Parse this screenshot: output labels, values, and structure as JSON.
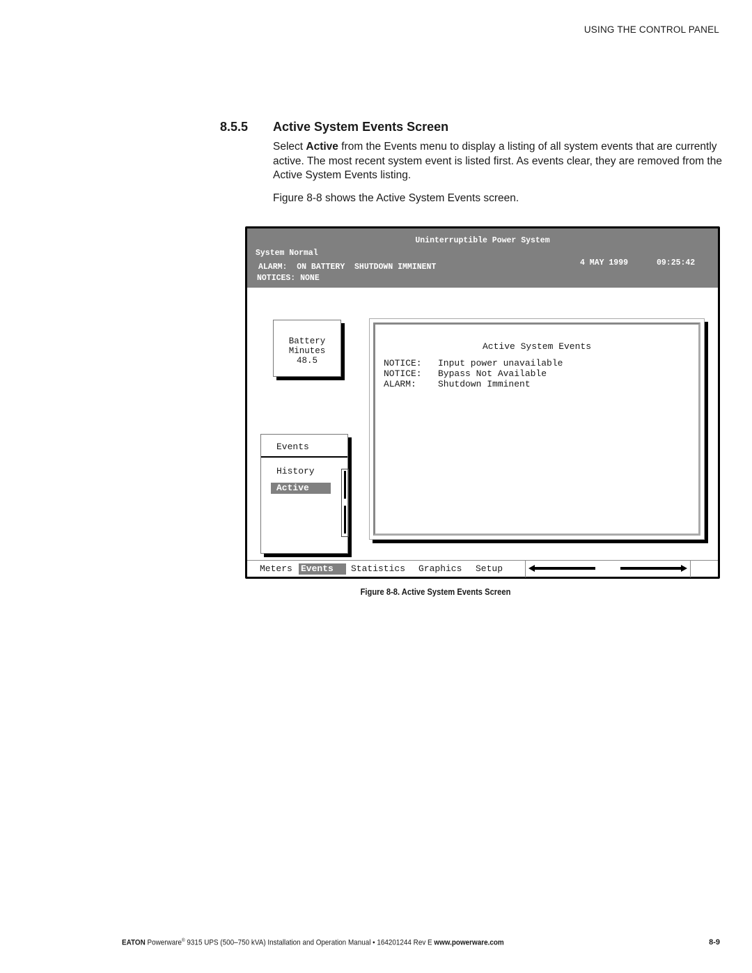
{
  "running_head": "USING THE CONTROL PANEL",
  "section": {
    "number": "8.5.5",
    "title": "Active System Events Screen",
    "para1_pre": "Select ",
    "para1_bold": "Active",
    "para1_post": " from the Events menu to display a listing of all system events that are currently active. The most recent system event is listed first. As events clear, they are removed from the Active System Events listing.",
    "para2": "Figure 8-8 shows the Active System Events screen."
  },
  "screen": {
    "header": {
      "title": "Uninterruptible Power System",
      "status": "System Normal",
      "alarm": "ALARM:  ON BATTERY  SHUTDOWN IMMINENT",
      "notices": "NOTICES: NONE",
      "date": "4 MAY 1999",
      "time": "09:25:42",
      "bg_color": "#808080"
    },
    "battery": {
      "line1": "Battery",
      "line2": "Minutes",
      "value": "48.5"
    },
    "events_panel": {
      "title": "Active System Events",
      "rows": [
        {
          "type": "NOTICE:",
          "message": "Input power unavailable"
        },
        {
          "type": "NOTICE:",
          "message": "Bypass Not Available"
        },
        {
          "type": "ALARM:",
          "message": "Shutdown Imminent"
        }
      ]
    },
    "menu": {
      "title": "Events",
      "items": [
        {
          "label": "History",
          "selected": false
        },
        {
          "label": "Active",
          "selected": true
        }
      ]
    },
    "tabs": [
      {
        "label": "Meters",
        "selected": false
      },
      {
        "label": "Events",
        "selected": true
      },
      {
        "label": "Statistics",
        "selected": false
      },
      {
        "label": "Graphics",
        "selected": false
      },
      {
        "label": "Setup",
        "selected": false
      }
    ],
    "nav": {
      "left": "left-arrow-icon",
      "right": "right-arrow-icon"
    }
  },
  "caption": "Figure 8-8. Active System Events Screen",
  "footer": {
    "brand": "EATON",
    "product": " Powerware",
    "reg": "®",
    "text": " 9315 UPS (500–750 kVA) Installation and Operation Manual  •  164201244 Rev E ",
    "url": "www.powerware.com",
    "page": "8-9"
  }
}
